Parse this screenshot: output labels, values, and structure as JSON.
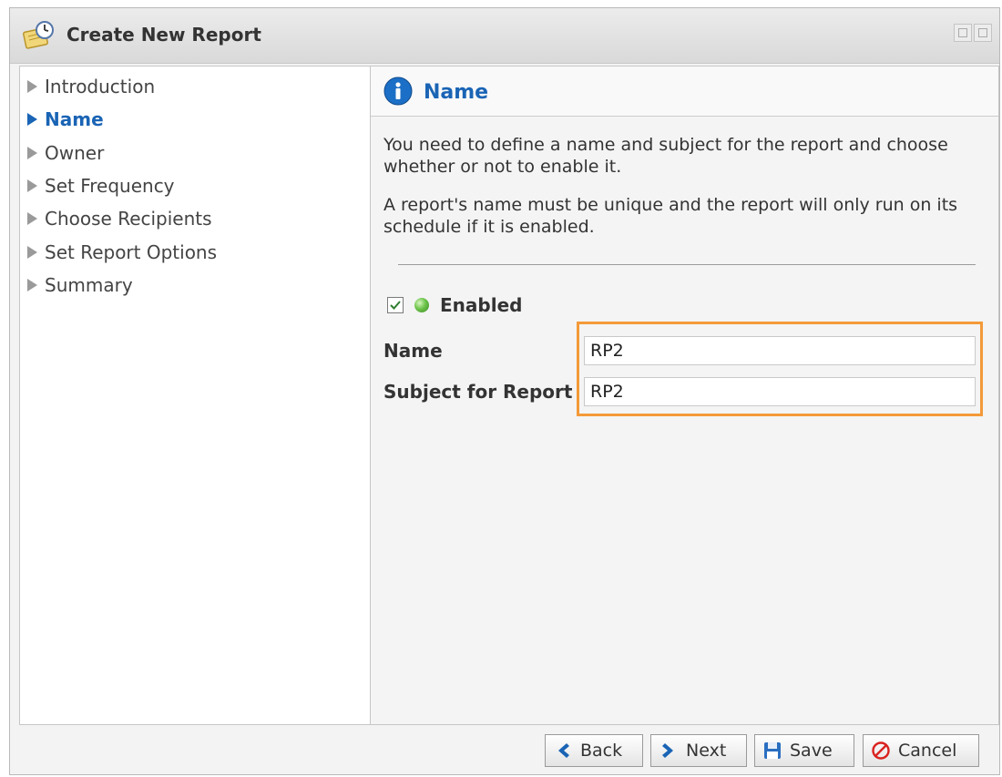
{
  "window": {
    "title": "Create New Report"
  },
  "nav": {
    "items": [
      {
        "label": "Introduction",
        "active": false
      },
      {
        "label": "Name",
        "active": true
      },
      {
        "label": "Owner",
        "active": false
      },
      {
        "label": "Set Frequency",
        "active": false
      },
      {
        "label": "Choose Recipients",
        "active": false
      },
      {
        "label": "Set Report Options",
        "active": false
      },
      {
        "label": "Summary",
        "active": false
      }
    ]
  },
  "content": {
    "header_title": "Name",
    "description_1": "You need to define a name and subject for the report and choose whether or not to enable it.",
    "description_2": "A report's name must be unique and the report will only run on its schedule if it is enabled.",
    "enabled": {
      "label": "Enabled",
      "checked": true,
      "status_color": "#5cb83a"
    },
    "fields": {
      "name_label": "Name",
      "name_value": "RP2",
      "subject_label": "Subject for Report",
      "subject_value": "RP2"
    }
  },
  "footer": {
    "back_label": "Back",
    "next_label": "Next",
    "save_label": "Save",
    "cancel_label": "Cancel"
  },
  "colors": {
    "accent": "#1a64b5",
    "highlight": "#f39a38",
    "cancel": "#d9231f"
  }
}
